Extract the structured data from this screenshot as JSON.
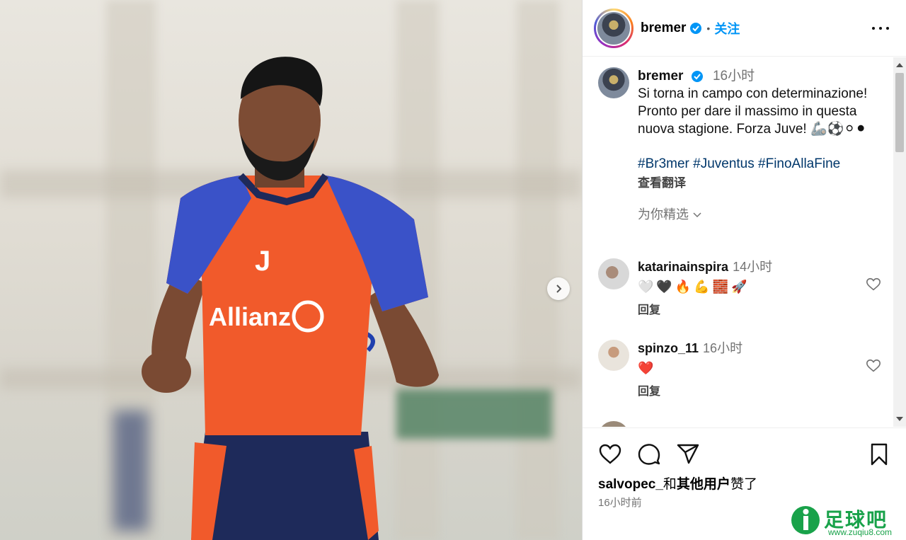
{
  "post": {
    "username": "bremer",
    "follow_label": "关注",
    "separator": "•"
  },
  "caption": {
    "username": "bremer",
    "time": "16小时",
    "text": "Si torna in campo con determinazione! Pronto per dare il massimo in questa nuova stagione. Forza Juve! 🦾⚽⚪⚫",
    "hashtags": "#Br3mer #Juventus #FinoAllaFine",
    "translate_label": "查看翻译",
    "for_you_label": "为你精选"
  },
  "comments": [
    {
      "username": "katarinainspira",
      "time": "14小时",
      "text": "🤍🖤🔥💪🧱🚀",
      "reply_label": "回复"
    },
    {
      "username": "spinzo_11",
      "time": "16小时",
      "text": "❤️",
      "reply_label": "回复"
    }
  ],
  "footer": {
    "liked_user": "salvopec_",
    "liked_connector": "和",
    "liked_others": "其他用户",
    "liked_suffix": "赞了",
    "time": "16小时前"
  },
  "jersey": {
    "sponsor": "Allianz"
  },
  "watermark": {
    "name": "足球吧",
    "url": "www.zuqiu8.com"
  },
  "colors": {
    "accent": "#0095f6",
    "hashtag": "#00376b",
    "muted": "#737373",
    "heart_red": "#ed4956",
    "watermark": "#19a24a"
  },
  "icons": [
    "verified-icon",
    "more-icon",
    "chevron-right-icon",
    "chevron-down-icon",
    "heart-icon",
    "comment-icon",
    "share-icon",
    "bookmark-icon"
  ]
}
